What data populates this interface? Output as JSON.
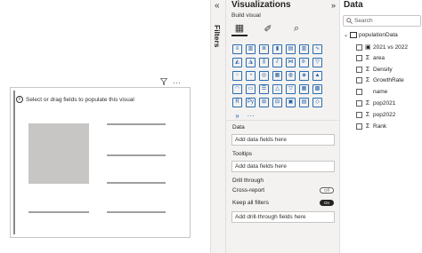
{
  "canvas": {
    "placeholder_message": "Select or drag fields to populate this visual",
    "header_icons": [
      "filter-icon",
      "more-options-icon"
    ],
    "more_glyph": "···"
  },
  "filters_pane": {
    "label": "Filters",
    "collapse_glyph": "«"
  },
  "visualizations": {
    "title": "Visualizations",
    "collapse_glyph": "»",
    "subtitle": "Build visual",
    "tabs": [
      {
        "icon": "build-visual-icon",
        "glyph": "▦",
        "active": true
      },
      {
        "icon": "format-visual-icon",
        "glyph": "✐",
        "active": false
      },
      {
        "icon": "analytics-icon",
        "glyph": "⌕",
        "active": false
      }
    ],
    "visual_icons": [
      {
        "name": "stacked-bar-chart-icon",
        "glyph": "≡"
      },
      {
        "name": "stacked-column-chart-icon",
        "glyph": "▥"
      },
      {
        "name": "clustered-bar-chart-icon",
        "glyph": "≣"
      },
      {
        "name": "clustered-column-chart-icon",
        "glyph": "▮"
      },
      {
        "name": "100-stacked-bar-chart-icon",
        "glyph": "▤"
      },
      {
        "name": "100-stacked-column-chart-icon",
        "glyph": "▥"
      },
      {
        "name": "line-chart-icon",
        "glyph": "∿"
      },
      {
        "name": "area-chart-icon",
        "glyph": "◭"
      },
      {
        "name": "stacked-area-chart-icon",
        "glyph": "◮"
      },
      {
        "name": "line-clustered-column-chart-icon",
        "glyph": "⫼"
      },
      {
        "name": "line-stacked-column-chart-icon",
        "glyph": "⫽"
      },
      {
        "name": "ribbon-chart-icon",
        "glyph": "⋈"
      },
      {
        "name": "waterfall-chart-icon",
        "glyph": "⊪"
      },
      {
        "name": "funnel-chart-icon",
        "glyph": "▽"
      },
      {
        "name": "scatter-chart-icon",
        "glyph": "⁘"
      },
      {
        "name": "pie-chart-icon",
        "glyph": "◔"
      },
      {
        "name": "donut-chart-icon",
        "glyph": "◎"
      },
      {
        "name": "treemap-icon",
        "glyph": "▦"
      },
      {
        "name": "map-icon",
        "glyph": "◍"
      },
      {
        "name": "filled-map-icon",
        "glyph": "◈"
      },
      {
        "name": "azure-map-icon",
        "glyph": "▲"
      },
      {
        "name": "gauge-icon",
        "glyph": "◠"
      },
      {
        "name": "card-icon",
        "glyph": "▭"
      },
      {
        "name": "multi-row-card-icon",
        "glyph": "☰"
      },
      {
        "name": "kpi-icon",
        "glyph": "△"
      },
      {
        "name": "slicer-icon",
        "glyph": "▽"
      },
      {
        "name": "table-icon",
        "glyph": "▦"
      },
      {
        "name": "matrix-icon",
        "glyph": "▩"
      },
      {
        "name": "r-visual-icon",
        "glyph": "R"
      },
      {
        "name": "python-visual-icon",
        "glyph": "Py"
      },
      {
        "name": "key-influencers-icon",
        "glyph": "⊞"
      },
      {
        "name": "decomposition-tree-icon",
        "glyph": "⊟"
      },
      {
        "name": "qa-icon",
        "glyph": "▣"
      },
      {
        "name": "smart-narrative-icon",
        "glyph": "▤"
      },
      {
        "name": "paginated-report-icon",
        "glyph": "◇"
      },
      {
        "name": "power-apps-icon",
        "glyph": "»",
        "plain": true
      },
      {
        "name": "more-visuals-icon",
        "glyph": "···",
        "plain": true
      }
    ],
    "data_label": "Data",
    "data_placeholder": "Add data fields here",
    "tooltips_label": "Tooltips",
    "tooltips_placeholder": "Add data fields here",
    "drill_label": "Drill through",
    "cross_report_label": "Cross-report",
    "cross_report_state": "Off",
    "keep_filters_label": "Keep all filters",
    "keep_filters_state": "On",
    "drill_placeholder": "Add drill-through fields here"
  },
  "data_pane": {
    "title": "Data",
    "search_placeholder": "Search",
    "table_name": "populationData",
    "fields": [
      {
        "label": "2021 vs 2022",
        "sym": "▣"
      },
      {
        "label": "area",
        "sym": "Σ"
      },
      {
        "label": "Density",
        "sym": "Σ"
      },
      {
        "label": "GrowthRate",
        "sym": "Σ"
      },
      {
        "label": "name",
        "sym": ""
      },
      {
        "label": "pop2021",
        "sym": "Σ"
      },
      {
        "label": "pop2022",
        "sym": "Σ"
      },
      {
        "label": "Rank",
        "sym": "Σ"
      }
    ]
  }
}
